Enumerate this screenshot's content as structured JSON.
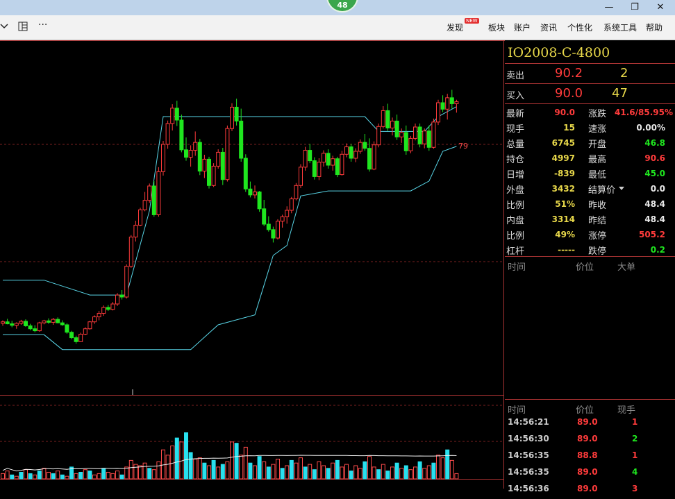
{
  "header": {
    "badge": "48"
  },
  "window_controls": {
    "minimize": "—",
    "restore": "❐",
    "close": "✕"
  },
  "toolbar": {
    "icons": [
      "chevron-down-icon",
      "layout-icon",
      "more-icon"
    ],
    "more_label": "···"
  },
  "menu": {
    "items": [
      {
        "label": "发现",
        "badge": "NEW"
      },
      {
        "label": "板块"
      },
      {
        "label": "账户"
      },
      {
        "label": "资讯"
      },
      {
        "label": "个性化"
      },
      {
        "label": "系统工具"
      },
      {
        "label": "帮助"
      }
    ]
  },
  "chart": {
    "price_marker_label": "79",
    "colors": {
      "up": "#ff3b3b",
      "down": "#1fe61f",
      "band": "#59d6e8",
      "volume_up": "#ff4b4b",
      "volume_down": "#28e0ee"
    }
  },
  "chart_data": {
    "type": "candlestick",
    "title": "",
    "x": "bar index (intraday)",
    "y_unit": "price",
    "guide_price": 79,
    "candles": [
      [
        1,
        45.3,
        45.9,
        44.8,
        45.6
      ],
      [
        2,
        45.6,
        46.2,
        45.1,
        45.2
      ],
      [
        3,
        45.2,
        45.8,
        44.5,
        44.9
      ],
      [
        4,
        44.9,
        45.5,
        44.2,
        45.3
      ],
      [
        5,
        45.3,
        46.0,
        45.0,
        45.7
      ],
      [
        6,
        45.7,
        46.1,
        44.6,
        44.8
      ],
      [
        7,
        44.8,
        45.2,
        43.9,
        44.2
      ],
      [
        8,
        44.2,
        44.9,
        43.5,
        43.8
      ],
      [
        9,
        43.8,
        45.6,
        43.6,
        45.4
      ],
      [
        10,
        45.4,
        46.0,
        45.1,
        45.8
      ],
      [
        11,
        45.8,
        46.3,
        45.2,
        45.5
      ],
      [
        12,
        45.5,
        46.4,
        45.0,
        46.1
      ],
      [
        13,
        46.1,
        46.5,
        45.3,
        45.4
      ],
      [
        14,
        45.4,
        45.9,
        44.8,
        45.0
      ],
      [
        15,
        45.0,
        45.3,
        43.2,
        43.5
      ],
      [
        16,
        43.5,
        43.8,
        42.1,
        42.4
      ],
      [
        17,
        42.4,
        42.8,
        41.2,
        41.6
      ],
      [
        18,
        41.6,
        43.4,
        41.5,
        43.1
      ],
      [
        19,
        43.1,
        44.5,
        42.9,
        44.2
      ],
      [
        20,
        44.2,
        45.8,
        44.0,
        45.6
      ],
      [
        21,
        45.6,
        46.9,
        45.2,
        46.6
      ],
      [
        22,
        46.6,
        47.8,
        45.9,
        47.3
      ],
      [
        23,
        47.3,
        48.9,
        46.8,
        48.5
      ],
      [
        24,
        48.5,
        49.0,
        47.8,
        48.1
      ],
      [
        25,
        48.1,
        49.6,
        47.9,
        49.2
      ],
      [
        26,
        49.2,
        51.4,
        48.8,
        51.0
      ],
      [
        27,
        51.0,
        52.0,
        50.1,
        50.6
      ],
      [
        28,
        50.6,
        57.2,
        50.3,
        56.8
      ],
      [
        29,
        56.8,
        63.1,
        56.5,
        62.7
      ],
      [
        30,
        62.7,
        66.0,
        61.8,
        65.1
      ],
      [
        31,
        65.1,
        68.6,
        64.9,
        68.2
      ],
      [
        32,
        68.2,
        71.8,
        67.9,
        70.1
      ],
      [
        33,
        70.1,
        73.5,
        69.6,
        73.0
      ],
      [
        34,
        73.0,
        74.0,
        66.8,
        67.2
      ],
      [
        35,
        67.2,
        76.8,
        66.8,
        75.9
      ],
      [
        36,
        75.9,
        82.1,
        75.1,
        81.4
      ],
      [
        37,
        81.4,
        86.2,
        80.5,
        85.6
      ],
      [
        38,
        85.6,
        89.5,
        84.2,
        88.7
      ],
      [
        39,
        88.7,
        90.2,
        85.1,
        86.3
      ],
      [
        40,
        86.3,
        87.4,
        79.8,
        80.3
      ],
      [
        41,
        80.3,
        82.8,
        78.1,
        78.8
      ],
      [
        42,
        78.8,
        81.2,
        76.9,
        80.2
      ],
      [
        43,
        80.2,
        84.0,
        79.1,
        81.8
      ],
      [
        44,
        81.8,
        82.5,
        75.2,
        76.0
      ],
      [
        45,
        76.0,
        79.3,
        74.6,
        78.4
      ],
      [
        46,
        78.4,
        78.9,
        72.5,
        73.1
      ],
      [
        47,
        73.1,
        77.6,
        72.8,
        77.0
      ],
      [
        48,
        77.0,
        80.4,
        76.5,
        79.8
      ],
      [
        49,
        79.8,
        80.7,
        73.2,
        74.3
      ],
      [
        50,
        74.3,
        85.2,
        73.9,
        84.6
      ],
      [
        51,
        84.6,
        89.7,
        84.1,
        88.9
      ],
      [
        52,
        88.9,
        90.6,
        85.2,
        86.1
      ],
      [
        53,
        86.1,
        88.6,
        77.9,
        78.6
      ],
      [
        54,
        78.6,
        79.4,
        71.8,
        72.4
      ],
      [
        55,
        72.4,
        73.9,
        70.7,
        71.2
      ],
      [
        56,
        71.2,
        73.1,
        70.5,
        71.8
      ],
      [
        57,
        71.8,
        72.0,
        67.8,
        68.4
      ],
      [
        58,
        68.4,
        70.2,
        64.9,
        65.3
      ],
      [
        59,
        65.3,
        66.9,
        63.8,
        64.2
      ],
      [
        60,
        64.2,
        64.8,
        61.6,
        62.5
      ],
      [
        61,
        62.5,
        66.3,
        62.2,
        65.9
      ],
      [
        62,
        65.9,
        67.2,
        64.6,
        66.8
      ],
      [
        63,
        66.8,
        68.9,
        65.4,
        68.1
      ],
      [
        64,
        68.1,
        70.8,
        67.5,
        70.4
      ],
      [
        65,
        70.4,
        73.6,
        70.1,
        73.1
      ],
      [
        66,
        73.1,
        77.4,
        72.6,
        76.8
      ],
      [
        67,
        76.8,
        80.9,
        76.1,
        80.2
      ],
      [
        68,
        80.2,
        81.5,
        77.6,
        78.1
      ],
      [
        69,
        78.1,
        78.8,
        74.3,
        74.9
      ],
      [
        70,
        74.9,
        78.6,
        74.2,
        77.8
      ],
      [
        71,
        77.8,
        80.2,
        76.9,
        79.6
      ],
      [
        72,
        79.6,
        80.4,
        76.5,
        77.2
      ],
      [
        73,
        77.2,
        79.1,
        76.1,
        78.5
      ],
      [
        74,
        78.5,
        78.9,
        74.8,
        75.3
      ],
      [
        75,
        75.3,
        80.1,
        75.1,
        79.4
      ],
      [
        76,
        79.4,
        81.6,
        78.8,
        80.9
      ],
      [
        77,
        80.9,
        81.5,
        77.9,
        78.6
      ],
      [
        78,
        78.6,
        80.6,
        77.8,
        80.0
      ],
      [
        79,
        80.0,
        82.4,
        79.5,
        81.8
      ],
      [
        80,
        81.8,
        83.5,
        80.1,
        80.6
      ],
      [
        81,
        80.6,
        82.6,
        75.9,
        76.4
      ],
      [
        82,
        76.4,
        82.0,
        76.2,
        81.3
      ],
      [
        83,
        81.3,
        85.6,
        80.8,
        85.0
      ],
      [
        84,
        85.0,
        89.1,
        84.6,
        88.2
      ],
      [
        85,
        88.2,
        89.6,
        84.1,
        84.7
      ],
      [
        86,
        84.7,
        86.8,
        83.2,
        86.1
      ],
      [
        87,
        86.1,
        87.4,
        82.3,
        82.9
      ],
      [
        88,
        82.9,
        84.6,
        81.7,
        83.8
      ],
      [
        89,
        83.8,
        85.2,
        79.3,
        80.1
      ],
      [
        90,
        80.1,
        83.1,
        79.6,
        82.6
      ],
      [
        91,
        82.6,
        85.6,
        82.2,
        84.9
      ],
      [
        92,
        84.9,
        85.6,
        80.8,
        81.5
      ],
      [
        93,
        81.5,
        84.6,
        80.6,
        84.1
      ],
      [
        94,
        84.1,
        85.2,
        80.1,
        80.8
      ],
      [
        95,
        80.8,
        86.6,
        80.5,
        85.9
      ],
      [
        96,
        85.9,
        90.4,
        85.3,
        89.8
      ],
      [
        97,
        89.8,
        91.3,
        87.9,
        88.5
      ],
      [
        98,
        88.5,
        91.6,
        86.4,
        90.8
      ],
      [
        99,
        90.8,
        92.4,
        88.6,
        89.6
      ],
      [
        100,
        89.6,
        90.4,
        87.8,
        90.0
      ]
    ],
    "band_upper": [
      [
        1,
        54.0
      ],
      [
        10,
        54.0
      ],
      [
        20,
        51.0
      ],
      [
        28,
        51.0
      ],
      [
        33,
        68.0
      ],
      [
        36,
        87.0
      ],
      [
        52,
        87.0
      ],
      [
        80,
        87.0
      ],
      [
        83,
        84.0
      ],
      [
        93,
        84.0
      ],
      [
        96,
        87.0
      ],
      [
        100,
        89.0
      ]
    ],
    "band_lower": [
      [
        1,
        43.0
      ],
      [
        10,
        43.0
      ],
      [
        14,
        40.0
      ],
      [
        33,
        40.0
      ],
      [
        42,
        40.0
      ],
      [
        48,
        45.0
      ],
      [
        56,
        47.0
      ],
      [
        60,
        59.0
      ],
      [
        63,
        61.0
      ],
      [
        66,
        71.0
      ],
      [
        72,
        72.0
      ],
      [
        90,
        72.0
      ],
      [
        94,
        74.0
      ],
      [
        97,
        80.0
      ],
      [
        100,
        81.0
      ]
    ],
    "volume": [
      [
        1,
        4,
        1
      ],
      [
        2,
        6,
        1
      ],
      [
        3,
        3,
        0
      ],
      [
        4,
        2,
        1
      ],
      [
        5,
        5,
        0
      ],
      [
        6,
        7,
        1
      ],
      [
        7,
        4,
        0
      ],
      [
        8,
        3,
        1
      ],
      [
        9,
        6,
        0
      ],
      [
        10,
        8,
        1
      ],
      [
        11,
        5,
        1
      ],
      [
        12,
        4,
        0
      ],
      [
        13,
        6,
        1
      ],
      [
        14,
        3,
        0
      ],
      [
        15,
        2,
        1
      ],
      [
        16,
        9,
        0
      ],
      [
        17,
        4,
        1
      ],
      [
        18,
        5,
        0
      ],
      [
        19,
        7,
        1
      ],
      [
        20,
        6,
        0
      ],
      [
        21,
        3,
        1
      ],
      [
        22,
        4,
        1
      ],
      [
        23,
        8,
        0
      ],
      [
        24,
        5,
        1
      ],
      [
        25,
        4,
        1
      ],
      [
        26,
        6,
        1
      ],
      [
        27,
        3,
        0
      ],
      [
        28,
        9,
        1
      ],
      [
        29,
        14,
        1
      ],
      [
        30,
        11,
        1
      ],
      [
        31,
        10,
        1
      ],
      [
        32,
        12,
        1
      ],
      [
        33,
        8,
        0
      ],
      [
        34,
        7,
        1
      ],
      [
        35,
        13,
        1
      ],
      [
        36,
        22,
        1
      ],
      [
        37,
        18,
        1
      ],
      [
        38,
        25,
        1
      ],
      [
        39,
        31,
        0
      ],
      [
        40,
        28,
        1
      ],
      [
        41,
        35,
        0
      ],
      [
        42,
        20,
        0
      ],
      [
        43,
        15,
        1
      ],
      [
        44,
        16,
        1
      ],
      [
        45,
        12,
        0
      ],
      [
        46,
        10,
        1
      ],
      [
        47,
        14,
        0
      ],
      [
        48,
        9,
        1
      ],
      [
        49,
        11,
        0
      ],
      [
        50,
        13,
        1
      ],
      [
        51,
        28,
        1
      ],
      [
        52,
        27,
        0
      ],
      [
        53,
        18,
        1
      ],
      [
        54,
        24,
        1
      ],
      [
        55,
        12,
        0
      ],
      [
        56,
        10,
        1
      ],
      [
        57,
        17,
        0
      ],
      [
        58,
        13,
        1
      ],
      [
        59,
        9,
        0
      ],
      [
        60,
        11,
        1
      ],
      [
        61,
        15,
        1
      ],
      [
        62,
        8,
        0
      ],
      [
        63,
        10,
        1
      ],
      [
        64,
        14,
        0
      ],
      [
        65,
        12,
        1
      ],
      [
        66,
        16,
        1
      ],
      [
        67,
        9,
        0
      ],
      [
        68,
        11,
        1
      ],
      [
        69,
        7,
        0
      ],
      [
        70,
        13,
        1
      ],
      [
        71,
        10,
        1
      ],
      [
        72,
        8,
        0
      ],
      [
        73,
        12,
        1
      ],
      [
        74,
        14,
        0
      ],
      [
        75,
        9,
        1
      ],
      [
        76,
        11,
        1
      ],
      [
        77,
        6,
        0
      ],
      [
        78,
        10,
        1
      ],
      [
        79,
        8,
        1
      ],
      [
        80,
        13,
        0
      ],
      [
        81,
        17,
        1
      ],
      [
        82,
        9,
        1
      ],
      [
        83,
        7,
        0
      ],
      [
        84,
        11,
        1
      ],
      [
        85,
        6,
        0
      ],
      [
        86,
        9,
        1
      ],
      [
        87,
        12,
        0
      ],
      [
        88,
        8,
        1
      ],
      [
        89,
        10,
        0
      ],
      [
        90,
        7,
        1
      ],
      [
        91,
        9,
        1
      ],
      [
        92,
        13,
        0
      ],
      [
        93,
        8,
        1
      ],
      [
        94,
        10,
        1
      ],
      [
        95,
        12,
        0
      ],
      [
        96,
        18,
        1
      ],
      [
        97,
        16,
        1
      ],
      [
        98,
        22,
        0
      ],
      [
        99,
        14,
        1
      ],
      [
        100,
        4,
        1
      ]
    ]
  },
  "quote": {
    "symbol": "IO2008-C-4800",
    "sell": {
      "label": "卖出",
      "price": "90.2",
      "qty": "2"
    },
    "buy": {
      "label": "买入",
      "price": "90.0",
      "qty": "47"
    },
    "left_fields": [
      {
        "label": "最新",
        "value": "90.0",
        "color": "#ff3b3b"
      },
      {
        "label": "现手",
        "value": "15",
        "color": "#e8d84a"
      },
      {
        "label": "总量",
        "value": "6745",
        "color": "#e8d84a"
      },
      {
        "label": "持仓",
        "value": "4997",
        "color": "#e8d84a"
      },
      {
        "label": "日增",
        "value": "-839",
        "color": "#e8d84a"
      },
      {
        "label": "外盘",
        "value": "3432",
        "color": "#e8d84a"
      },
      {
        "label": "比例",
        "value": "51%",
        "color": "#e8d84a"
      },
      {
        "label": "内盘",
        "value": "3314",
        "color": "#e8d84a"
      },
      {
        "label": "比例",
        "value": "49%",
        "color": "#e8d84a"
      },
      {
        "label": "杠杆",
        "value": "-----",
        "color": "#e8d84a"
      }
    ],
    "right_fields": [
      {
        "label": "涨跌",
        "value": "41.6/85.95%",
        "color": "#ff3b3b"
      },
      {
        "label": "速涨",
        "value": "0.00%",
        "color": "#e8e8e8"
      },
      {
        "label": "开盘",
        "value": "46.8",
        "color": "#1fe61f"
      },
      {
        "label": "最高",
        "value": "90.6",
        "color": "#ff3b3b"
      },
      {
        "label": "最低",
        "value": "45.0",
        "color": "#1fe61f"
      },
      {
        "label": "结算价",
        "value": "0.0",
        "color": "#e8e8e8"
      },
      {
        "label": "昨收",
        "value": "48.4",
        "color": "#e8e8e8"
      },
      {
        "label": "昨结",
        "value": "48.4",
        "color": "#e8e8e8"
      },
      {
        "label": "涨停",
        "value": "505.2",
        "color": "#ff3b3b"
      },
      {
        "label": "跌停",
        "value": "0.2",
        "color": "#1fe61f"
      }
    ]
  },
  "big_orders": {
    "headers": [
      "时间",
      "价位",
      "大单"
    ]
  },
  "ticks": {
    "headers": [
      "时间",
      "价位",
      "现手"
    ],
    "rows": [
      {
        "time": "14:56:21",
        "price": "89.0",
        "qty": "1",
        "qty_color": "#ff3b3b"
      },
      {
        "time": "14:56:30",
        "price": "89.0",
        "qty": "2",
        "qty_color": "#1fe61f"
      },
      {
        "time": "14:56:35",
        "price": "88.8",
        "qty": "1",
        "qty_color": "#ff3b3b"
      },
      {
        "time": "14:56:35",
        "price": "89.0",
        "qty": "4",
        "qty_color": "#1fe61f"
      },
      {
        "time": "14:56:36",
        "price": "89.0",
        "qty": "3",
        "qty_color": "#ff3b3b"
      }
    ]
  }
}
